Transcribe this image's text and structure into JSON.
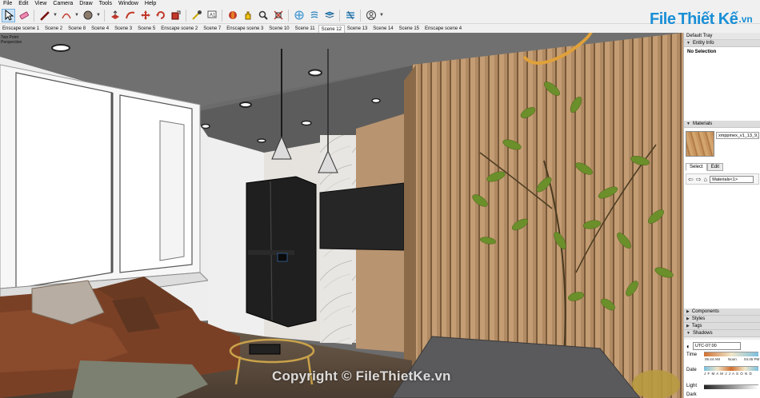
{
  "menu": [
    "File",
    "Edit",
    "View",
    "Camera",
    "Draw",
    "Tools",
    "Window",
    "Help"
  ],
  "toolbar_icons": [
    "select-icon",
    "eraser-icon",
    "pencil-icon",
    "line-dropdown",
    "arc-icon",
    "arc-dropdown",
    "paint-bucket-icon",
    "paint-dropdown",
    "push-pull-icon",
    "follow-me-icon",
    "move-icon",
    "rotate-icon",
    "scale-icon",
    "tape-measure-icon",
    "text-icon",
    "orbit-icon",
    "pan-icon",
    "zoom-icon",
    "zoom-extents-icon",
    "sandbox-icon",
    "component-icon",
    "layers-icon",
    "enscape-icon",
    "user-icon",
    "user-dropdown"
  ],
  "brand": {
    "part1": "File",
    "part2": "Thiết Kế",
    "part3": ".vn",
    "color": "#1a8fd6"
  },
  "scene_tabs": [
    "Enscape scene 1",
    "Scene 2",
    "Scene 8",
    "Scene 4",
    "Scene 3",
    "Scene 5",
    "Enscape scene 2",
    "Scene 7",
    "Enscape scene 3",
    "Scene 10",
    "Scene 11",
    "Scene 12",
    "Scene 13",
    "Scene 14",
    "Scene 15",
    "Enscape scene 4"
  ],
  "active_scene": "Scene 12",
  "viewport": {
    "label_line1": "Two Point",
    "label_line2": "Perspective",
    "watermark": "Copyright © FileThietKe.vn"
  },
  "tray": {
    "title": "Default Tray",
    "entity_info": {
      "header": "Entity Info",
      "value": "No Selection"
    },
    "materials": {
      "header": "Materials",
      "name": "xmppmex_v1_13_9_",
      "tabs": [
        "Select",
        "Edit"
      ],
      "active_tab": "Select",
      "dropdown": "Materials<1>"
    },
    "panels": [
      "Components",
      "Styles",
      "Tags"
    ],
    "shadows": {
      "header": "Shadows",
      "timezone": "UTC-07:00",
      "time_label": "Time",
      "time_start": "06:44 AM",
      "time_noon": "Noon",
      "time_end": "04:45 PM",
      "date_label": "Date",
      "months": "J F M A M J J A S O N D",
      "light_label": "Light",
      "dark_label": "Dark"
    }
  }
}
